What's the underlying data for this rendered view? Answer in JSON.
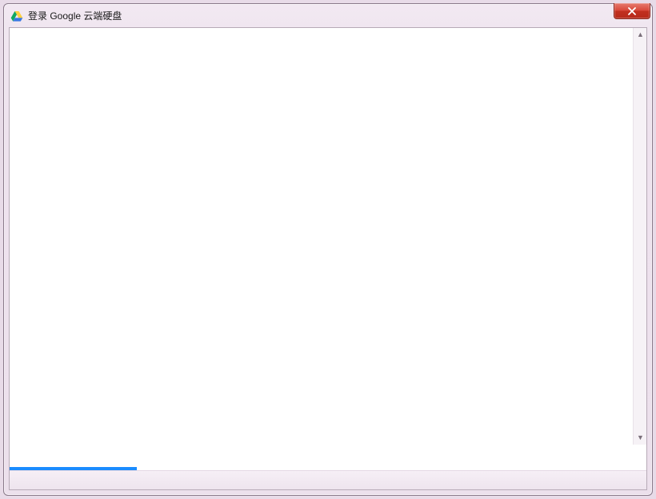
{
  "window": {
    "title": "登录 Google 云端硬盘"
  },
  "progress": {
    "percent": 20
  }
}
